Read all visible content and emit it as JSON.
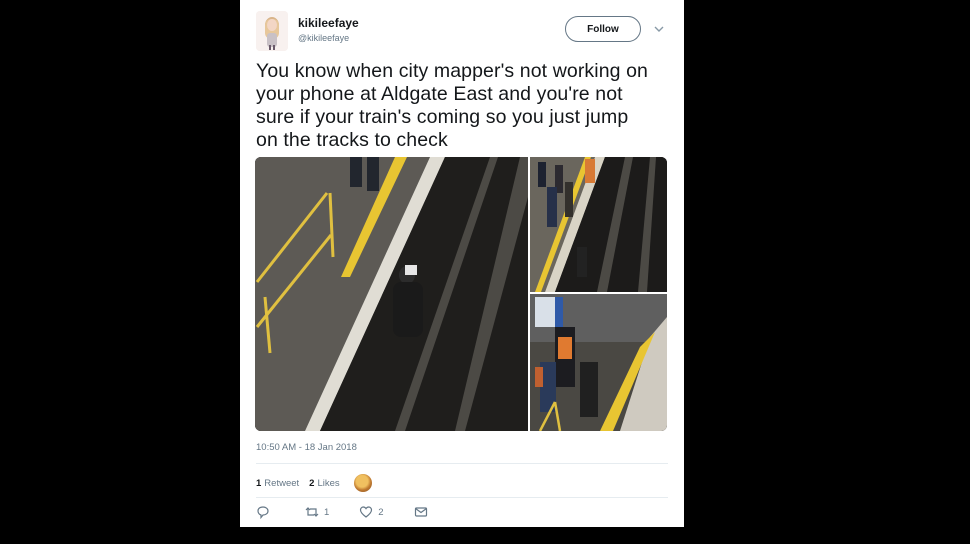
{
  "user": {
    "display_name": "kikileefaye",
    "handle": "@kikileefaye",
    "follow_label": "Follow"
  },
  "tweet": {
    "text_lines": [
      "You know when city mapper's not working on",
      "your phone at Aldgate East and you're not",
      "sure if your train's coming so you just jump",
      "on the tracks to check"
    ],
    "timestamp": "10:50 AM - 18 Jan 2018"
  },
  "stats": {
    "retweets_count": "1",
    "retweets_label": "Retweet",
    "likes_count": "2",
    "likes_label": "Likes"
  },
  "actions": {
    "reply_count": "",
    "retweet_count": "1",
    "like_count": "2"
  },
  "icons": [
    "caret-down-icon",
    "reply-icon",
    "retweet-icon",
    "heart-icon",
    "message-icon"
  ],
  "colors": {
    "text": "#14171a",
    "secondary": "#657786",
    "divider": "#e6ecf0",
    "platform_line": "#e8c532"
  }
}
